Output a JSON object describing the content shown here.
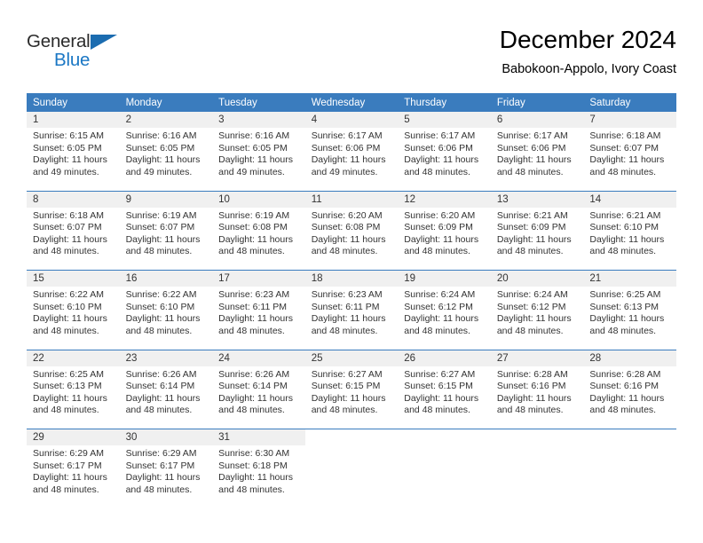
{
  "logo": {
    "word_one": "General",
    "word_two": "Blue",
    "icon": "triangle-mark"
  },
  "header": {
    "title": "December 2024",
    "subtitle": "Babokoon-Appolo, Ivory Coast"
  },
  "colors": {
    "header_blue": "#3a7cbe",
    "logo_blue": "#1b77c4",
    "daynum_band": "#f0f0f0",
    "text": "#333333"
  },
  "weekdays": [
    "Sunday",
    "Monday",
    "Tuesday",
    "Wednesday",
    "Thursday",
    "Friday",
    "Saturday"
  ],
  "labels": {
    "sunrise_prefix": "Sunrise:",
    "sunset_prefix": "Sunset:",
    "daylight_prefix": "Daylight:"
  },
  "weeks": [
    [
      {
        "day": "1",
        "sunrise": "Sunrise: 6:15 AM",
        "sunset": "Sunset: 6:05 PM",
        "daylight_1": "Daylight: 11 hours",
        "daylight_2": "and 49 minutes."
      },
      {
        "day": "2",
        "sunrise": "Sunrise: 6:16 AM",
        "sunset": "Sunset: 6:05 PM",
        "daylight_1": "Daylight: 11 hours",
        "daylight_2": "and 49 minutes."
      },
      {
        "day": "3",
        "sunrise": "Sunrise: 6:16 AM",
        "sunset": "Sunset: 6:05 PM",
        "daylight_1": "Daylight: 11 hours",
        "daylight_2": "and 49 minutes."
      },
      {
        "day": "4",
        "sunrise": "Sunrise: 6:17 AM",
        "sunset": "Sunset: 6:06 PM",
        "daylight_1": "Daylight: 11 hours",
        "daylight_2": "and 49 minutes."
      },
      {
        "day": "5",
        "sunrise": "Sunrise: 6:17 AM",
        "sunset": "Sunset: 6:06 PM",
        "daylight_1": "Daylight: 11 hours",
        "daylight_2": "and 48 minutes."
      },
      {
        "day": "6",
        "sunrise": "Sunrise: 6:17 AM",
        "sunset": "Sunset: 6:06 PM",
        "daylight_1": "Daylight: 11 hours",
        "daylight_2": "and 48 minutes."
      },
      {
        "day": "7",
        "sunrise": "Sunrise: 6:18 AM",
        "sunset": "Sunset: 6:07 PM",
        "daylight_1": "Daylight: 11 hours",
        "daylight_2": "and 48 minutes."
      }
    ],
    [
      {
        "day": "8",
        "sunrise": "Sunrise: 6:18 AM",
        "sunset": "Sunset: 6:07 PM",
        "daylight_1": "Daylight: 11 hours",
        "daylight_2": "and 48 minutes."
      },
      {
        "day": "9",
        "sunrise": "Sunrise: 6:19 AM",
        "sunset": "Sunset: 6:07 PM",
        "daylight_1": "Daylight: 11 hours",
        "daylight_2": "and 48 minutes."
      },
      {
        "day": "10",
        "sunrise": "Sunrise: 6:19 AM",
        "sunset": "Sunset: 6:08 PM",
        "daylight_1": "Daylight: 11 hours",
        "daylight_2": "and 48 minutes."
      },
      {
        "day": "11",
        "sunrise": "Sunrise: 6:20 AM",
        "sunset": "Sunset: 6:08 PM",
        "daylight_1": "Daylight: 11 hours",
        "daylight_2": "and 48 minutes."
      },
      {
        "day": "12",
        "sunrise": "Sunrise: 6:20 AM",
        "sunset": "Sunset: 6:09 PM",
        "daylight_1": "Daylight: 11 hours",
        "daylight_2": "and 48 minutes."
      },
      {
        "day": "13",
        "sunrise": "Sunrise: 6:21 AM",
        "sunset": "Sunset: 6:09 PM",
        "daylight_1": "Daylight: 11 hours",
        "daylight_2": "and 48 minutes."
      },
      {
        "day": "14",
        "sunrise": "Sunrise: 6:21 AM",
        "sunset": "Sunset: 6:10 PM",
        "daylight_1": "Daylight: 11 hours",
        "daylight_2": "and 48 minutes."
      }
    ],
    [
      {
        "day": "15",
        "sunrise": "Sunrise: 6:22 AM",
        "sunset": "Sunset: 6:10 PM",
        "daylight_1": "Daylight: 11 hours",
        "daylight_2": "and 48 minutes."
      },
      {
        "day": "16",
        "sunrise": "Sunrise: 6:22 AM",
        "sunset": "Sunset: 6:10 PM",
        "daylight_1": "Daylight: 11 hours",
        "daylight_2": "and 48 minutes."
      },
      {
        "day": "17",
        "sunrise": "Sunrise: 6:23 AM",
        "sunset": "Sunset: 6:11 PM",
        "daylight_1": "Daylight: 11 hours",
        "daylight_2": "and 48 minutes."
      },
      {
        "day": "18",
        "sunrise": "Sunrise: 6:23 AM",
        "sunset": "Sunset: 6:11 PM",
        "daylight_1": "Daylight: 11 hours",
        "daylight_2": "and 48 minutes."
      },
      {
        "day": "19",
        "sunrise": "Sunrise: 6:24 AM",
        "sunset": "Sunset: 6:12 PM",
        "daylight_1": "Daylight: 11 hours",
        "daylight_2": "and 48 minutes."
      },
      {
        "day": "20",
        "sunrise": "Sunrise: 6:24 AM",
        "sunset": "Sunset: 6:12 PM",
        "daylight_1": "Daylight: 11 hours",
        "daylight_2": "and 48 minutes."
      },
      {
        "day": "21",
        "sunrise": "Sunrise: 6:25 AM",
        "sunset": "Sunset: 6:13 PM",
        "daylight_1": "Daylight: 11 hours",
        "daylight_2": "and 48 minutes."
      }
    ],
    [
      {
        "day": "22",
        "sunrise": "Sunrise: 6:25 AM",
        "sunset": "Sunset: 6:13 PM",
        "daylight_1": "Daylight: 11 hours",
        "daylight_2": "and 48 minutes."
      },
      {
        "day": "23",
        "sunrise": "Sunrise: 6:26 AM",
        "sunset": "Sunset: 6:14 PM",
        "daylight_1": "Daylight: 11 hours",
        "daylight_2": "and 48 minutes."
      },
      {
        "day": "24",
        "sunrise": "Sunrise: 6:26 AM",
        "sunset": "Sunset: 6:14 PM",
        "daylight_1": "Daylight: 11 hours",
        "daylight_2": "and 48 minutes."
      },
      {
        "day": "25",
        "sunrise": "Sunrise: 6:27 AM",
        "sunset": "Sunset: 6:15 PM",
        "daylight_1": "Daylight: 11 hours",
        "daylight_2": "and 48 minutes."
      },
      {
        "day": "26",
        "sunrise": "Sunrise: 6:27 AM",
        "sunset": "Sunset: 6:15 PM",
        "daylight_1": "Daylight: 11 hours",
        "daylight_2": "and 48 minutes."
      },
      {
        "day": "27",
        "sunrise": "Sunrise: 6:28 AM",
        "sunset": "Sunset: 6:16 PM",
        "daylight_1": "Daylight: 11 hours",
        "daylight_2": "and 48 minutes."
      },
      {
        "day": "28",
        "sunrise": "Sunrise: 6:28 AM",
        "sunset": "Sunset: 6:16 PM",
        "daylight_1": "Daylight: 11 hours",
        "daylight_2": "and 48 minutes."
      }
    ],
    [
      {
        "day": "29",
        "sunrise": "Sunrise: 6:29 AM",
        "sunset": "Sunset: 6:17 PM",
        "daylight_1": "Daylight: 11 hours",
        "daylight_2": "and 48 minutes."
      },
      {
        "day": "30",
        "sunrise": "Sunrise: 6:29 AM",
        "sunset": "Sunset: 6:17 PM",
        "daylight_1": "Daylight: 11 hours",
        "daylight_2": "and 48 minutes."
      },
      {
        "day": "31",
        "sunrise": "Sunrise: 6:30 AM",
        "sunset": "Sunset: 6:18 PM",
        "daylight_1": "Daylight: 11 hours",
        "daylight_2": "and 48 minutes."
      },
      {
        "day": "",
        "sunrise": "",
        "sunset": "",
        "daylight_1": "",
        "daylight_2": ""
      },
      {
        "day": "",
        "sunrise": "",
        "sunset": "",
        "daylight_1": "",
        "daylight_2": ""
      },
      {
        "day": "",
        "sunrise": "",
        "sunset": "",
        "daylight_1": "",
        "daylight_2": ""
      },
      {
        "day": "",
        "sunrise": "",
        "sunset": "",
        "daylight_1": "",
        "daylight_2": ""
      }
    ]
  ]
}
